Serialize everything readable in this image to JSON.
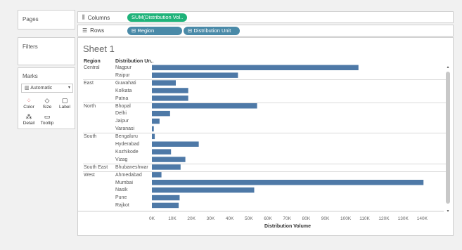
{
  "left_panels": {
    "pages_title": "Pages",
    "filters_title": "Filters",
    "marks_title": "Marks",
    "marks_type": "Automatic",
    "marks_buttons": [
      "Color",
      "Size",
      "Label",
      "Detail",
      "Tooltip"
    ]
  },
  "shelves": {
    "columns_label": "Columns",
    "rows_label": "Rows",
    "columns_pill": "SUM(Distribution Vol..",
    "rows_pills": [
      "Region",
      "Distribution Unit"
    ]
  },
  "sheet": {
    "title": "Sheet 1",
    "region_header": "Region",
    "unit_header": "Distribution Un.."
  },
  "colors": {
    "bar": "#4e79a7",
    "columns_pill": "#1fb37a",
    "rows_pill": "#4a8aa8"
  },
  "chart_data": {
    "type": "bar",
    "orientation": "horizontal",
    "xlabel": "Distribution Volume",
    "xlim": [
      0,
      150000
    ],
    "x_ticks": [
      "0K",
      "10K",
      "20K",
      "30K",
      "40K",
      "50K",
      "60K",
      "70K",
      "80K",
      "90K",
      "100K",
      "110K",
      "120K",
      "130K",
      "140K"
    ],
    "groups": [
      {
        "region": "Central",
        "units": [
          "Nagpur",
          "Raipur"
        ],
        "values": [
          108000,
          45000
        ]
      },
      {
        "region": "East",
        "units": [
          "Guwahati",
          "Kolkata",
          "Patna"
        ],
        "values": [
          12500,
          19000,
          19000
        ]
      },
      {
        "region": "North",
        "units": [
          "Bhopal",
          "Delhi",
          "Jaipur",
          "Varanasi"
        ],
        "values": [
          55000,
          9500,
          4000,
          1000
        ]
      },
      {
        "region": "South",
        "units": [
          "Bengaluru",
          "Hyderabad",
          "Kozhikode",
          "Vizag"
        ],
        "values": [
          1500,
          24500,
          10000,
          17500
        ]
      },
      {
        "region": "South East",
        "units": [
          "Bhubaneshwar"
        ],
        "values": [
          15000
        ]
      },
      {
        "region": "West",
        "units": [
          "Ahmedabad",
          "Mumbai",
          "Nasik",
          "Pune",
          "Rajkot"
        ],
        "values": [
          5000,
          142000,
          53500,
          14500,
          14000
        ]
      }
    ]
  }
}
